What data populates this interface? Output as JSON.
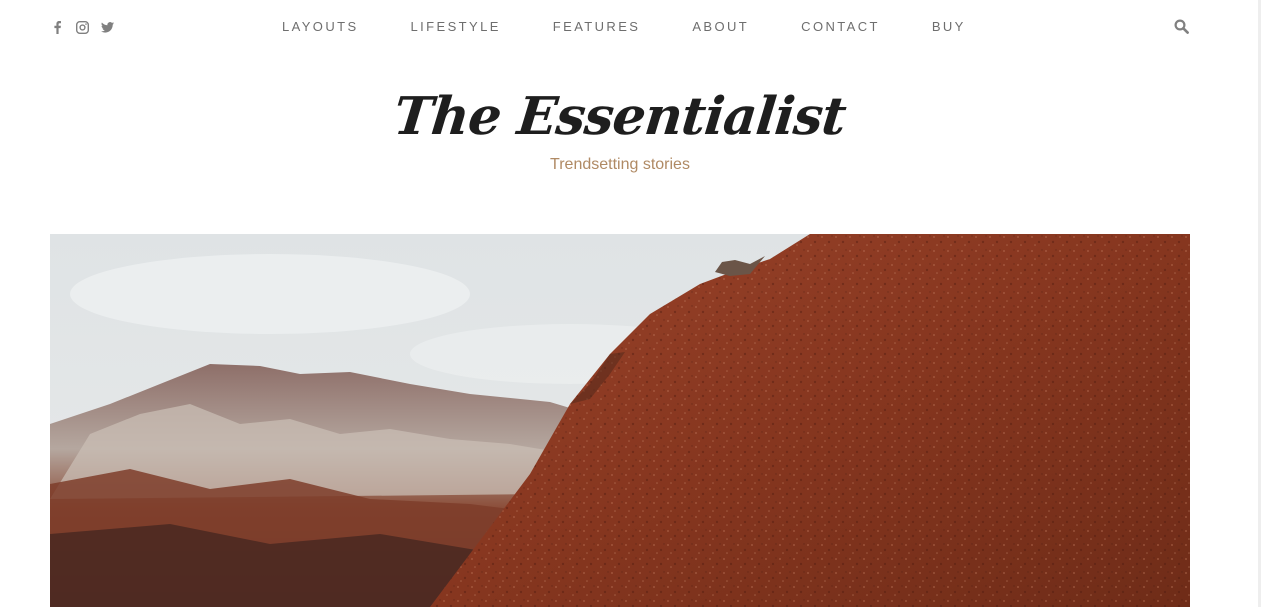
{
  "social": {
    "icons": [
      "facebook-icon",
      "instagram-icon",
      "twitter-icon"
    ]
  },
  "nav": {
    "items": [
      "LAYOUTS",
      "LIFESTYLE",
      "FEATURES",
      "ABOUT",
      "CONTACT",
      "BUY"
    ]
  },
  "search": {
    "icon": "search-icon"
  },
  "brand": {
    "title": "The Essentialist",
    "tagline": "Trendsetting stories"
  },
  "hero": {
    "image": "red-desert-mountain-photo"
  },
  "colors": {
    "nav_text": "#6e6e6e",
    "icon": "#808080",
    "title": "#1e1e1e",
    "tagline": "#b08a64",
    "sky": "#e4e6e7",
    "red_rock": "#8a3a22"
  }
}
